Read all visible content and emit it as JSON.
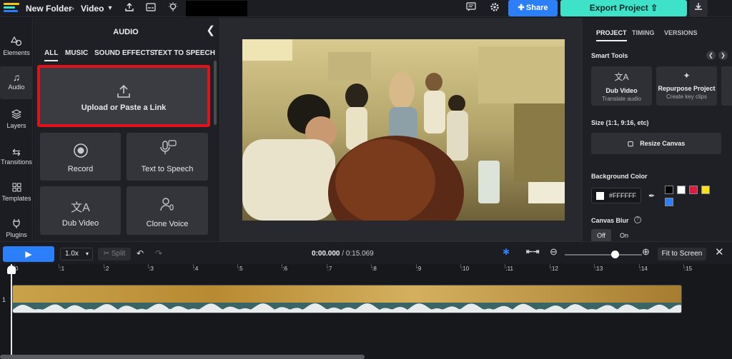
{
  "topbar": {
    "folder": "New Folder",
    "separator": ">",
    "project": "Video",
    "share_label": "Share",
    "export_label": "Export Project",
    "icons": [
      "upload-icon",
      "subtitles-icon",
      "lightbulb-icon",
      "comment-icon",
      "gear-icon",
      "download-icon"
    ]
  },
  "rail": {
    "items": [
      {
        "label": "Elements",
        "icon": "shapes-icon"
      },
      {
        "label": "Audio",
        "icon": "music-note-icon"
      },
      {
        "label": "Layers",
        "icon": "layers-icon"
      },
      {
        "label": "Transitions",
        "icon": "transitions-icon"
      },
      {
        "label": "Templates",
        "icon": "grid-icon"
      },
      {
        "label": "Plugins",
        "icon": "plug-icon"
      }
    ]
  },
  "audio_panel": {
    "title": "AUDIO",
    "tabs": [
      "ALL",
      "MUSIC",
      "SOUND EFFECTS",
      "TEXT TO SPEECH"
    ],
    "upload_label": "Upload or Paste a Link",
    "cards": [
      {
        "label": "Record",
        "icon": "record-icon"
      },
      {
        "label": "Text to Speech",
        "icon": "speech-bubble-mic-icon"
      },
      {
        "label": "Dub Video",
        "icon": "translate-icon"
      },
      {
        "label": "Clone Voice",
        "icon": "clone-voice-icon"
      }
    ]
  },
  "right_panel": {
    "tabs": [
      "PROJECT",
      "TIMING",
      "VERSIONS"
    ],
    "smart_tools_title": "Smart Tools",
    "tools": [
      {
        "title": "Dub Video",
        "subtitle": "Translate audio"
      },
      {
        "title": "Repurpose Project",
        "subtitle": "Create key clips"
      }
    ],
    "size_title": "Size (1:1, 9:16, etc)",
    "resize_label": "Resize Canvas",
    "bg_title": "Background Color",
    "bg_hex": "#FFFFFF",
    "swatches": [
      "#000000",
      "#FFFFFF",
      "#E5173F",
      "#F7E11B",
      "#2D7FF9"
    ],
    "blur_title": "Canvas Blur",
    "blur_off": "Off",
    "blur_on": "On"
  },
  "timeline_toolbar": {
    "speed": "1.0x",
    "split_label": "Split",
    "current_time": "0:00.000",
    "duration": "/ 0:15.069",
    "fit_label": "Fit to Screen",
    "zoom_level": 0.65
  },
  "timeline": {
    "ruler": [
      "0",
      ":1",
      ":2",
      ":3",
      ":4",
      ":5",
      ":6",
      ":7",
      ":8",
      ":9",
      ":10",
      ":11",
      ":12",
      ":13",
      ":14",
      ":15"
    ],
    "track_number": "1"
  },
  "colors": {
    "accent_blue": "#2D7FF9",
    "accent_teal": "#3EE2C8",
    "highlight_red": "#E1121A"
  }
}
